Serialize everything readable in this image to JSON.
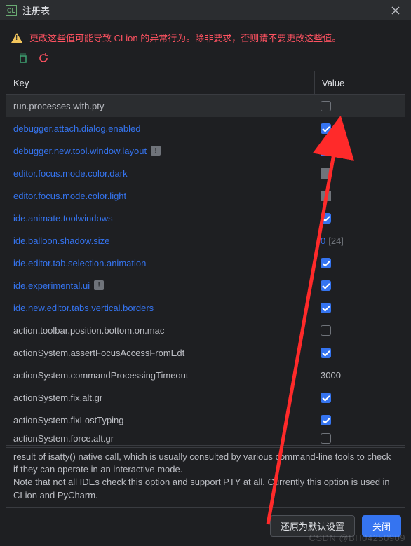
{
  "window": {
    "title": "注册表"
  },
  "warning": {
    "text": "更改这些值可能导致 CLion 的异常行为。除非要求，否则请不要更改这些值。"
  },
  "columns": {
    "key": "Key",
    "value": "Value"
  },
  "rows": [
    {
      "key": "run.processes.with.pty",
      "changed": false,
      "badge": false,
      "valueType": "checkbox",
      "checked": false,
      "selected": true
    },
    {
      "key": "debugger.attach.dialog.enabled",
      "changed": true,
      "badge": false,
      "valueType": "checkbox",
      "checked": true
    },
    {
      "key": "debugger.new.tool.window.layout",
      "changed": true,
      "badge": true,
      "valueType": "checkbox",
      "checked": true
    },
    {
      "key": "editor.focus.mode.color.dark",
      "changed": true,
      "badge": false,
      "valueType": "swatch"
    },
    {
      "key": "editor.focus.mode.color.light",
      "changed": true,
      "badge": false,
      "valueType": "swatch"
    },
    {
      "key": "ide.animate.toolwindows",
      "changed": true,
      "badge": false,
      "valueType": "checkbox",
      "checked": true
    },
    {
      "key": "ide.balloon.shadow.size",
      "changed": true,
      "badge": false,
      "valueType": "text",
      "value": "0",
      "default": "[24]"
    },
    {
      "key": "ide.editor.tab.selection.animation",
      "changed": true,
      "badge": false,
      "valueType": "checkbox",
      "checked": true
    },
    {
      "key": "ide.experimental.ui",
      "changed": true,
      "badge": true,
      "valueType": "checkbox",
      "checked": true
    },
    {
      "key": "ide.new.editor.tabs.vertical.borders",
      "changed": true,
      "badge": false,
      "valueType": "checkbox",
      "checked": true
    },
    {
      "key": "action.toolbar.position.bottom.on.mac",
      "changed": false,
      "badge": false,
      "valueType": "checkbox",
      "checked": false
    },
    {
      "key": "actionSystem.assertFocusAccessFromEdt",
      "changed": false,
      "badge": false,
      "valueType": "checkbox",
      "checked": true
    },
    {
      "key": "actionSystem.commandProcessingTimeout",
      "changed": false,
      "badge": false,
      "valueType": "text",
      "value": "3000"
    },
    {
      "key": "actionSystem.fix.alt.gr",
      "changed": false,
      "badge": false,
      "valueType": "checkbox",
      "checked": true
    },
    {
      "key": "actionSystem.fixLostTyping",
      "changed": false,
      "badge": false,
      "valueType": "checkbox",
      "checked": true
    },
    {
      "key": "actionSystem.force.alt.gr",
      "changed": false,
      "badge": false,
      "valueType": "checkbox",
      "checked": false,
      "partial": true
    }
  ],
  "description": {
    "line1": "result of isatty() native call, which is usually consulted by various command-line tools to check if they can operate in an interactive mode.",
    "line2": "Note that not all IDEs check this option and support PTY at all. Currently this option is used in CLion and PyCharm."
  },
  "buttons": {
    "restore": "还原为默认设置",
    "close": "关闭"
  },
  "watermark": "CSDN @BH04250909"
}
